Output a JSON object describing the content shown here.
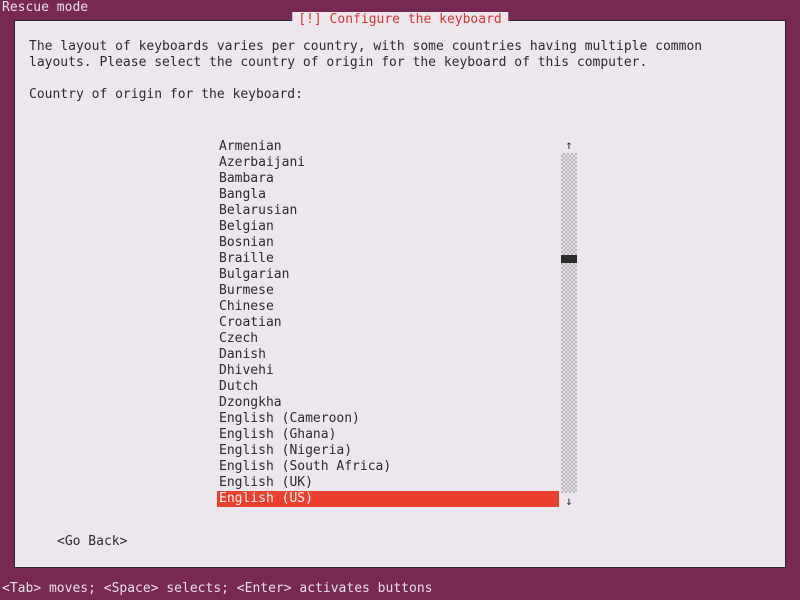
{
  "mode_label": "Rescue mode",
  "dialog": {
    "title": "[!] Configure the keyboard",
    "description": "The layout of keyboards varies per country, with some countries having multiple common layouts. Please select the country of origin for the keyboard of this computer.",
    "prompt": "Country of origin for the keyboard:",
    "go_back": "<Go Back>"
  },
  "list": {
    "items": [
      "Armenian",
      "Azerbaijani",
      "Bambara",
      "Bangla",
      "Belarusian",
      "Belgian",
      "Bosnian",
      "Braille",
      "Bulgarian",
      "Burmese",
      "Chinese",
      "Croatian",
      "Czech",
      "Danish",
      "Dhivehi",
      "Dutch",
      "Dzongkha",
      "English (Cameroon)",
      "English (Ghana)",
      "English (Nigeria)",
      "English (South Africa)",
      "English (UK)",
      "English (US)"
    ],
    "selected_index": 22
  },
  "scroll": {
    "up_glyph": "↑",
    "down_glyph": "↓"
  },
  "footer": "<Tab> moves; <Space> selects; <Enter> activates buttons"
}
